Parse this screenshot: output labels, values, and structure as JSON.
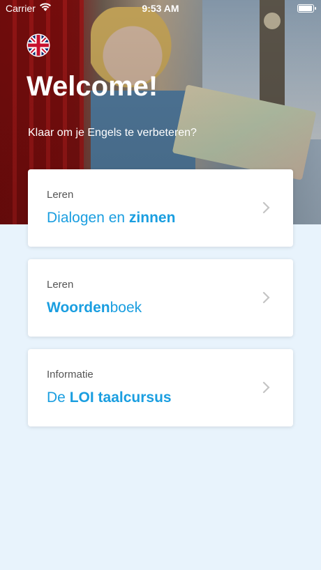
{
  "status": {
    "carrier": "Carrier",
    "time": "9:53 AM"
  },
  "hero": {
    "title": "Welcome!",
    "subtitle": "Klaar om je Engels te verbeteren?",
    "flag": "uk-flag-icon"
  },
  "cards": [
    {
      "category": "Leren",
      "title_parts": [
        {
          "text": "Dialogen en ",
          "bold": false
        },
        {
          "text": "zinnen",
          "bold": true
        }
      ]
    },
    {
      "category": "Leren",
      "title_parts": [
        {
          "text": "Woorden",
          "bold": true
        },
        {
          "text": "boek",
          "bold": false
        }
      ]
    },
    {
      "category": "Informatie",
      "title_parts": [
        {
          "text": "De ",
          "bold": false
        },
        {
          "text": "LOI taalcursus",
          "bold": true
        }
      ]
    }
  ],
  "colors": {
    "accent": "#1a9ee0",
    "background": "#e8f3fc"
  }
}
